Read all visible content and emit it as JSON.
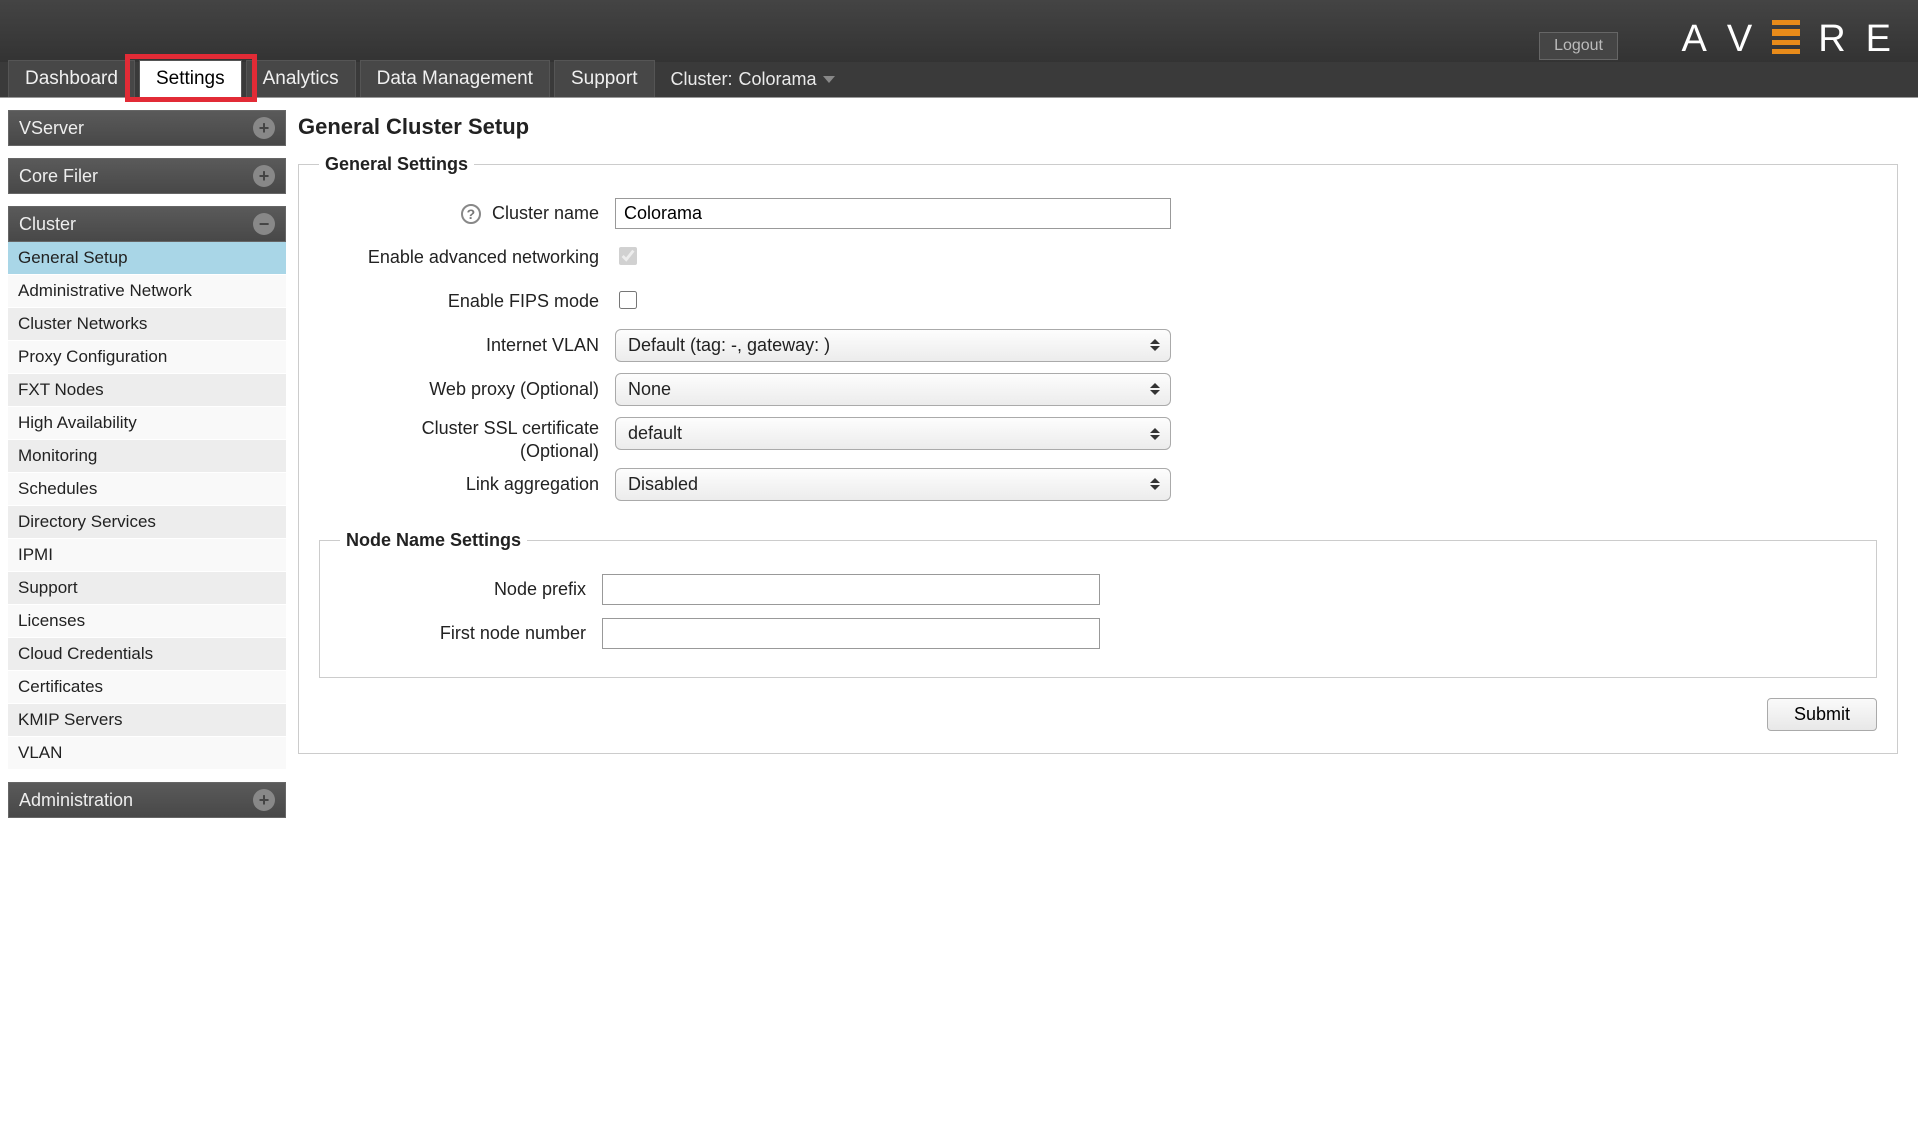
{
  "topbar": {
    "logout": "Logout",
    "logo_letters": [
      "A",
      "V",
      "R",
      "E"
    ]
  },
  "nav": {
    "tabs": [
      {
        "label": "Dashboard",
        "active": false
      },
      {
        "label": "Settings",
        "active": true
      },
      {
        "label": "Analytics",
        "active": false
      },
      {
        "label": "Data Management",
        "active": false
      },
      {
        "label": "Support",
        "active": false
      }
    ],
    "cluster_prefix": "Cluster:",
    "cluster_name": "Colorama"
  },
  "sidebar": {
    "sections": [
      {
        "title": "VServer",
        "expanded": false,
        "items": []
      },
      {
        "title": "Core Filer",
        "expanded": false,
        "items": []
      },
      {
        "title": "Cluster",
        "expanded": true,
        "items": [
          {
            "label": "General Setup",
            "active": true
          },
          {
            "label": "Administrative Network"
          },
          {
            "label": "Cluster Networks"
          },
          {
            "label": "Proxy Configuration"
          },
          {
            "label": "FXT Nodes"
          },
          {
            "label": "High Availability"
          },
          {
            "label": "Monitoring"
          },
          {
            "label": "Schedules"
          },
          {
            "label": "Directory Services"
          },
          {
            "label": "IPMI"
          },
          {
            "label": "Support"
          },
          {
            "label": "Licenses"
          },
          {
            "label": "Cloud Credentials"
          },
          {
            "label": "Certificates"
          },
          {
            "label": "KMIP Servers"
          },
          {
            "label": "VLAN"
          }
        ]
      },
      {
        "title": "Administration",
        "expanded": false,
        "items": []
      }
    ]
  },
  "page": {
    "title": "General Cluster Setup",
    "general_legend": "General Settings",
    "node_legend": "Node Name Settings",
    "labels": {
      "cluster_name": "Cluster name",
      "enable_adv_net": "Enable advanced networking",
      "enable_fips": "Enable FIPS mode",
      "internet_vlan": "Internet VLAN",
      "web_proxy": "Web proxy (Optional)",
      "ssl_cert_line1": "Cluster SSL certificate",
      "ssl_cert_line2": "(Optional)",
      "link_agg": "Link aggregation",
      "node_prefix": "Node prefix",
      "first_node_number": "First node number"
    },
    "values": {
      "cluster_name": "Colorama",
      "enable_adv_net": true,
      "enable_fips": false,
      "internet_vlan": "Default (tag: -, gateway:              )",
      "web_proxy": "None",
      "ssl_cert": "default",
      "link_agg": "Disabled",
      "node_prefix": "",
      "first_node_number": ""
    },
    "submit": "Submit"
  }
}
